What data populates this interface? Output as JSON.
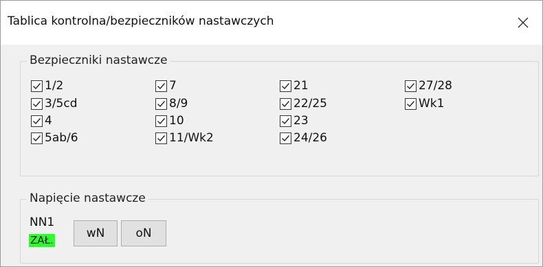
{
  "window": {
    "title": "Tablica kontrolna/bezpieczników nastawczych",
    "close_icon": "close-icon"
  },
  "fuses": {
    "title": "Bezpieczniki nastawcze",
    "items": [
      {
        "label": "1/2",
        "checked": true
      },
      {
        "label": "3/5cd",
        "checked": true
      },
      {
        "label": "4",
        "checked": true
      },
      {
        "label": "5ab/6",
        "checked": true
      },
      {
        "label": "7",
        "checked": true
      },
      {
        "label": "8/9",
        "checked": true
      },
      {
        "label": "10",
        "checked": true
      },
      {
        "label": "11/Wk2",
        "checked": true
      },
      {
        "label": "21",
        "checked": true
      },
      {
        "label": "22/25",
        "checked": true
      },
      {
        "label": "23",
        "checked": true
      },
      {
        "label": "24/26",
        "checked": true
      },
      {
        "label": "27/28",
        "checked": true
      },
      {
        "label": "Wk1",
        "checked": true
      }
    ]
  },
  "voltage": {
    "title": "Napięcie nastawcze",
    "nn_label": "NN1",
    "nn_status": "ZAŁ.",
    "status_color": "#2aff2a",
    "button_wn": "wN",
    "button_on": "oN"
  }
}
